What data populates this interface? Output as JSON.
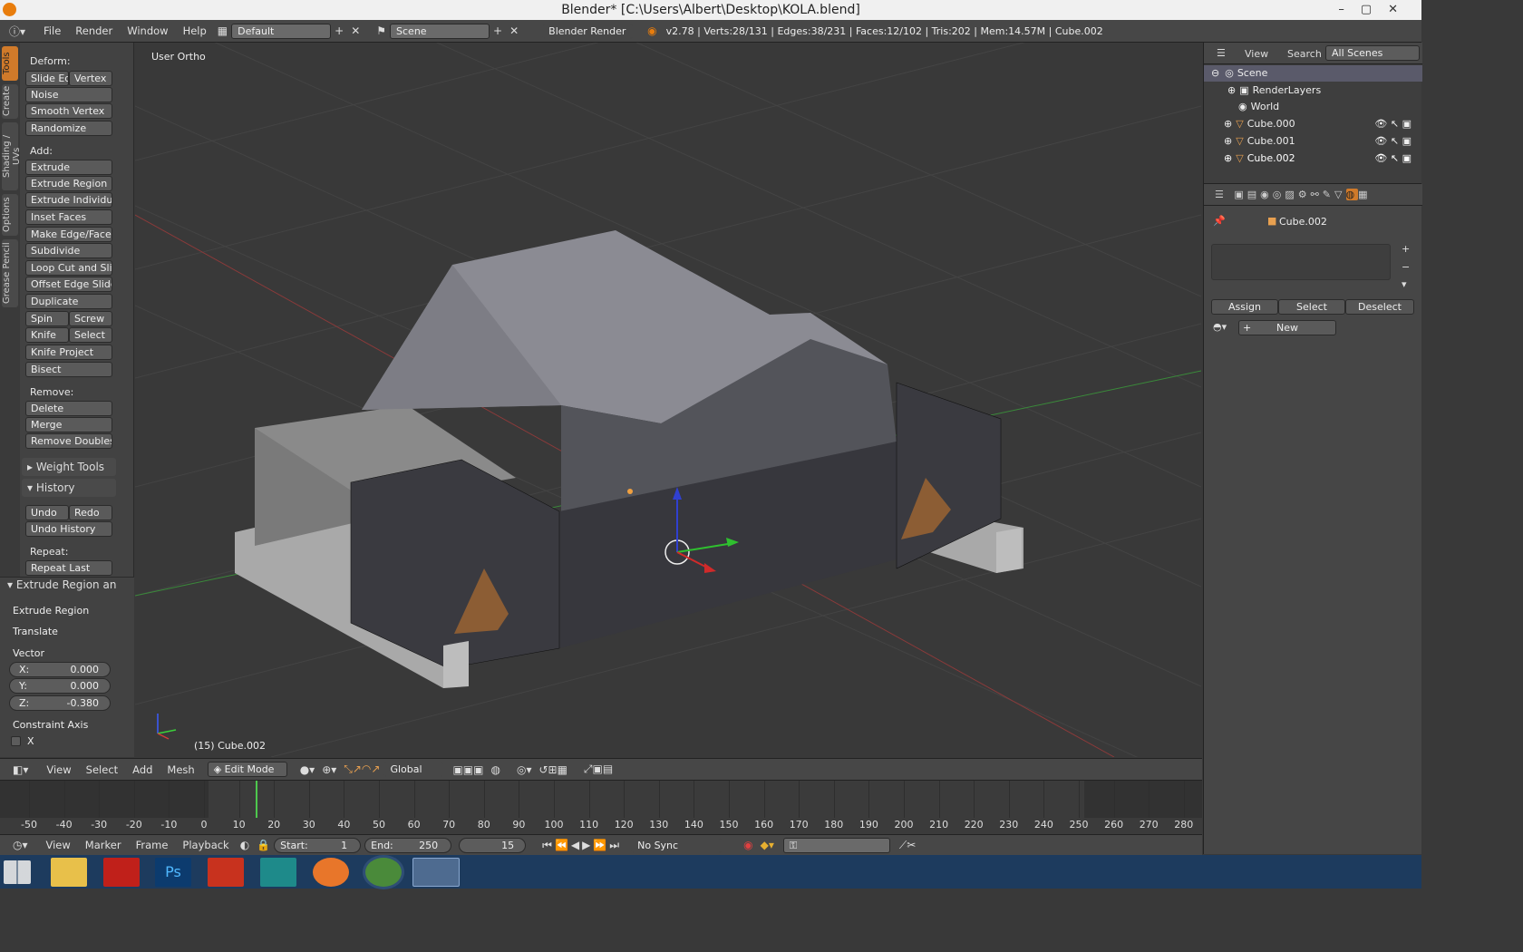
{
  "window": {
    "title": "Blender* [C:\\Users\\Albert\\Desktop\\KOLA.blend]"
  },
  "infobar": {
    "menus": [
      "File",
      "Render",
      "Window",
      "Help"
    ],
    "layout": "Default",
    "scene": "Scene",
    "engine": "Blender Render",
    "stats": "v2.78 | Verts:28/131 | Edges:38/231 | Faces:12/102 | Tris:202 | Mem:14.57M | Cube.002"
  },
  "tabs": [
    "Tools",
    "Create",
    "Shading / UVs",
    "Options",
    "Grease Pencil"
  ],
  "tools": {
    "deform_label": "Deform:",
    "slide_edge": "Slide Ed",
    "vertex": "Vertex",
    "noise": "Noise",
    "smooth_vertex": "Smooth Vertex",
    "randomize": "Randomize",
    "add_label": "Add:",
    "extrude": "Extrude",
    "extrude_region": "Extrude Region",
    "extrude_individual": "Extrude Individual",
    "inset_faces": "Inset Faces",
    "make_edge_face": "Make Edge/Face",
    "subdivide": "Subdivide",
    "loop_cut": "Loop Cut and Slide",
    "offset_edge": "Offset Edge Slide",
    "duplicate": "Duplicate",
    "spin": "Spin",
    "screw": "Screw",
    "knife": "Knife",
    "select": "Select",
    "knife_project": "Knife Project",
    "bisect": "Bisect",
    "remove_label": "Remove:",
    "delete": "Delete",
    "merge": "Merge",
    "remove_doubles": "Remove Doubles",
    "weight_tools": "Weight Tools",
    "history": "History",
    "undo": "Undo",
    "redo": "Redo",
    "undo_history": "Undo History",
    "repeat_label": "Repeat:",
    "repeat_last": "Repeat Last"
  },
  "operator": {
    "title": "Extrude Region and",
    "extrude_region": "Extrude Region",
    "translate": "Translate",
    "vector_label": "Vector",
    "x_label": "X:",
    "x": "0.000",
    "y_label": "Y:",
    "y": "0.000",
    "z_label": "Z:",
    "z": "-0.380",
    "constraint_label": "Constraint Axis",
    "cx": "X"
  },
  "viewport": {
    "view_name": "User Ortho",
    "object_info": "(15) Cube.002"
  },
  "view_header": {
    "items": [
      "View",
      "Select",
      "Add",
      "Mesh"
    ],
    "mode": "Edit Mode",
    "orientation": "Global"
  },
  "timeline": {
    "ticks": [
      "-50",
      "-40",
      "-30",
      "-20",
      "-10",
      "0",
      "10",
      "20",
      "30",
      "40",
      "50",
      "60",
      "70",
      "80",
      "90",
      "100",
      "110",
      "120",
      "130",
      "140",
      "150",
      "160",
      "170",
      "180",
      "190",
      "200",
      "210",
      "220",
      "230",
      "240",
      "250",
      "260",
      "270",
      "280"
    ],
    "current_frame": "15"
  },
  "timeline_header": {
    "items": [
      "View",
      "Marker",
      "Frame",
      "Playback"
    ],
    "start_label": "Start:",
    "start": "1",
    "end_label": "End:",
    "end": "250",
    "frame": "15",
    "sync": "No Sync"
  },
  "outliner": {
    "header": [
      "View",
      "Search",
      "All Scenes"
    ],
    "rows": [
      "Scene",
      "RenderLayers",
      "World",
      "Cube.000",
      "Cube.001",
      "Cube.002"
    ]
  },
  "properties": {
    "object": "Cube.002",
    "assign": "Assign",
    "select": "Select",
    "deselect": "Deselect",
    "new": "New"
  },
  "colors": {
    "accent": "#d07a2a",
    "bg": "#393939",
    "panel": "#424242"
  }
}
